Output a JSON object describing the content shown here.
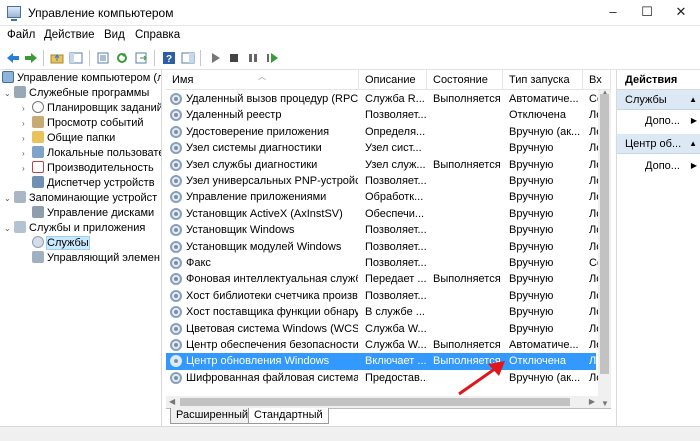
{
  "window": {
    "title": "Управление компьютером",
    "minimize": "–",
    "maximize": "☐",
    "close": "✕"
  },
  "menu": [
    "Файл",
    "Действие",
    "Вид",
    "Справка"
  ],
  "tree": [
    {
      "label": "Управление компьютером (л",
      "icon": "computer-management-icon",
      "level": 0,
      "toggle": ""
    },
    {
      "label": "Служебные программы",
      "icon": "tools-icon",
      "level": 1,
      "toggle": "⌄"
    },
    {
      "label": "Планировщик заданий",
      "icon": "clock-icon",
      "level": 2,
      "toggle": "›"
    },
    {
      "label": "Просмотр событий",
      "icon": "event-viewer-icon",
      "level": 2,
      "toggle": "›"
    },
    {
      "label": "Общие папки",
      "icon": "shared-folder-icon",
      "level": 2,
      "toggle": "›"
    },
    {
      "label": "Локальные пользовате",
      "icon": "users-icon",
      "level": 2,
      "toggle": "›"
    },
    {
      "label": "Производительность",
      "icon": "performance-icon",
      "level": 2,
      "toggle": "›"
    },
    {
      "label": "Диспетчер устройств",
      "icon": "device-manager-icon",
      "level": 2,
      "toggle": ""
    },
    {
      "label": "Запоминающие устройст",
      "icon": "storage-icon",
      "level": 1,
      "toggle": "⌄"
    },
    {
      "label": "Управление дисками",
      "icon": "disk-icon",
      "level": 2,
      "toggle": ""
    },
    {
      "label": "Службы и приложения",
      "icon": "services-apps-icon",
      "level": 1,
      "toggle": "⌄"
    },
    {
      "label": "Службы",
      "icon": "services-icon",
      "level": 2,
      "toggle": "",
      "selected": true
    },
    {
      "label": "Управляющий элемен",
      "icon": "wmi-icon",
      "level": 2,
      "toggle": ""
    }
  ],
  "columns": [
    {
      "label": "Имя"
    },
    {
      "label": "Описание"
    },
    {
      "label": "Состояние"
    },
    {
      "label": "Тип запуска"
    },
    {
      "label": "Вх"
    }
  ],
  "services": [
    {
      "name": "Удаленный вызов процедур (RPC)",
      "desc": "Служба R...",
      "state": "Выполняется",
      "startup": "Автоматиче...",
      "logon": "Се"
    },
    {
      "name": "Удаленный реестр",
      "desc": "Позволяет...",
      "state": "",
      "startup": "Отключена",
      "logon": "Ло"
    },
    {
      "name": "Удостоверение приложения",
      "desc": "Определя...",
      "state": "",
      "startup": "Вручную (ак...",
      "logon": "Ло"
    },
    {
      "name": "Узел системы диагностики",
      "desc": "Узел сист...",
      "state": "",
      "startup": "Вручную",
      "logon": "Ло"
    },
    {
      "name": "Узел службы диагностики",
      "desc": "Узел служ...",
      "state": "Выполняется",
      "startup": "Вручную",
      "logon": "Ло"
    },
    {
      "name": "Узел универсальных PNP-устройств",
      "desc": "Позволяет...",
      "state": "",
      "startup": "Вручную",
      "logon": "Ло"
    },
    {
      "name": "Управление приложениями",
      "desc": "Обработк...",
      "state": "",
      "startup": "Вручную",
      "logon": "Ло"
    },
    {
      "name": "Установщик ActiveX (AxInstSV)",
      "desc": "Обеспечи...",
      "state": "",
      "startup": "Вручную",
      "logon": "Ло"
    },
    {
      "name": "Установщик Windows",
      "desc": "Позволяет...",
      "state": "",
      "startup": "Вручную",
      "logon": "Ло"
    },
    {
      "name": "Установщик модулей Windows",
      "desc": "Позволяет...",
      "state": "",
      "startup": "Вручную",
      "logon": "Ло"
    },
    {
      "name": "Факс",
      "desc": "Позволяет...",
      "state": "",
      "startup": "Вручную",
      "logon": "Се"
    },
    {
      "name": "Фоновая интеллектуальная служб...",
      "desc": "Передает ...",
      "state": "Выполняется",
      "startup": "Вручную",
      "logon": "Ло"
    },
    {
      "name": "Хост библиотеки счетчика произв...",
      "desc": "Позволяет...",
      "state": "",
      "startup": "Вручную",
      "logon": "Ло"
    },
    {
      "name": "Хост поставщика функции обнару...",
      "desc": "В службе ...",
      "state": "",
      "startup": "Вручную",
      "logon": "Ло"
    },
    {
      "name": "Цветовая система Windows (WCS)",
      "desc": "Служба W...",
      "state": "",
      "startup": "Вручную",
      "logon": "Ло"
    },
    {
      "name": "Центр обеспечения безопасности",
      "desc": "Служба W...",
      "state": "Выполняется",
      "startup": "Автоматиче...",
      "logon": "Ло"
    },
    {
      "name": "Центр обновления Windows",
      "desc": "Включает ...",
      "state": "Выполняется",
      "startup": "Отключена",
      "logon": "Ло",
      "selected": true
    },
    {
      "name": "Шифрованная файловая система (...",
      "desc": "Предостав...",
      "state": "",
      "startup": "Вручную (ак...",
      "logon": "Ло"
    }
  ],
  "tabs": {
    "extended": "Расширенный",
    "standard": "Стандартный"
  },
  "actions": {
    "header": "Действия",
    "section1": "Службы",
    "more1": "Допо...",
    "section2": "Центр об...",
    "more2": "Допо..."
  },
  "colors": {
    "selection": "#3399ff",
    "arrow": "#e0161b"
  }
}
